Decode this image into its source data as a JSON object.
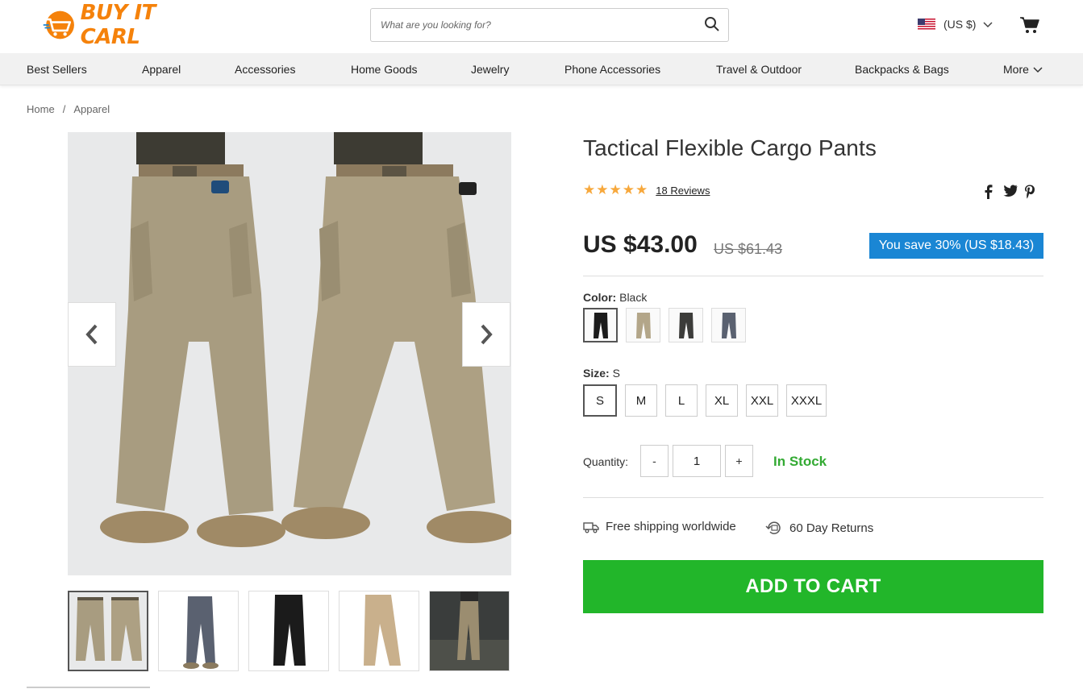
{
  "header": {
    "logo_text": "BUY IT CARL",
    "search_placeholder": "What are you looking for?",
    "currency_label": "(US $)",
    "brand_color": "#f5820b"
  },
  "nav": {
    "items": [
      "Best Sellers",
      "Apparel",
      "Accessories",
      "Home Goods",
      "Jewelry",
      "Phone Accessories",
      "Travel & Outdoor",
      "Backpacks & Bags",
      "More"
    ]
  },
  "breadcrumb": {
    "home": "Home",
    "separator": "/",
    "current": "Apparel"
  },
  "product": {
    "title": "Tactical Flexible Cargo Pants",
    "rating": 5,
    "reviews_label": "18 Reviews",
    "price": "US $43.00",
    "old_price": "US $61.43",
    "save_label": "You save 30% (US $18.43)",
    "color_label": "Color:",
    "color_value": "Black",
    "colors": [
      "black",
      "khaki",
      "dark-grey",
      "blue-grey"
    ],
    "size_label": "Size:",
    "size_value": "S",
    "sizes": [
      "S",
      "M",
      "L",
      "XL",
      "XXL",
      "XXXL"
    ],
    "selected_size": "S",
    "quantity_label": "Quantity:",
    "quantity_value": "1",
    "qty_minus": "-",
    "qty_plus": "+",
    "stock_label": "In Stock",
    "perk_shipping": "Free shipping worldwide",
    "perk_returns": "60 Day Returns",
    "add_to_cart_label": "ADD TO CART",
    "accent_green": "#22b62a",
    "accent_blue": "#1a86d4"
  },
  "gallery": {
    "thumbnails": [
      "khaki-front-pair",
      "blue-grey-pants",
      "black-pants",
      "khaki-side",
      "lifestyle-outdoor"
    ],
    "active_index": 0
  }
}
